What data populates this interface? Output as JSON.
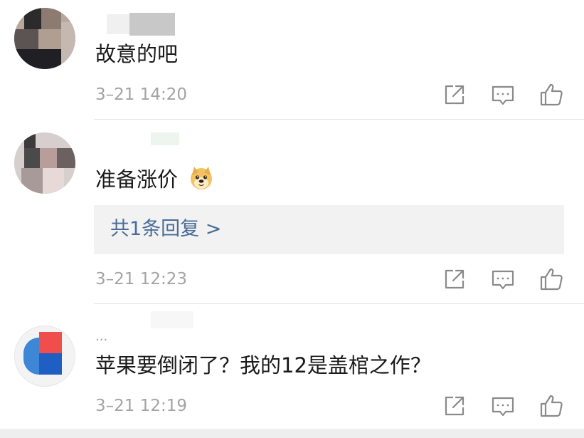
{
  "comments": [
    {
      "username": "",
      "text": "故意的吧",
      "time": "3–21 14:20",
      "reply_count_label": ""
    },
    {
      "username": "",
      "text": "准备涨价",
      "emoji": "doge-emoji",
      "reply_count_label": "共1条回复 >",
      "time": "3–21 12:23"
    },
    {
      "username": "...",
      "text": "苹果要倒闭了？我的12是盖棺之作？",
      "time": "3–21 12:19",
      "reply_count_label": ""
    }
  ],
  "actions": {
    "share_icon": "share-icon",
    "comment_icon": "comment-icon",
    "like_icon": "thumbs-up-icon"
  },
  "colors": {
    "text": "#1a1a1a",
    "meta": "#a3a3a3",
    "link": "#4a6c96",
    "reply_bg": "#f2f2f2",
    "divider": "#e3e3e3"
  }
}
